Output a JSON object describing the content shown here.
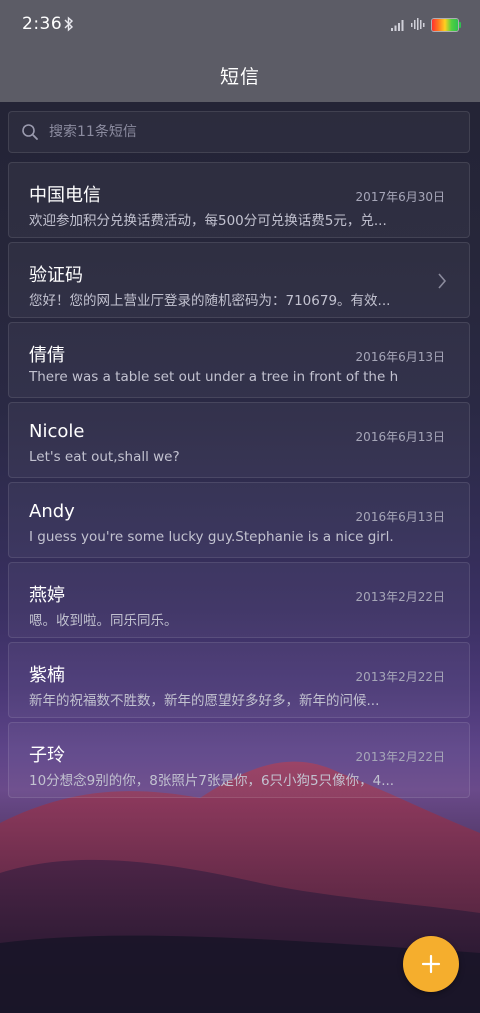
{
  "status_bar": {
    "time": "2:36"
  },
  "header": {
    "title": "短信"
  },
  "search": {
    "placeholder": "搜索11条短信"
  },
  "messages": [
    {
      "name": "中国电信",
      "date": "2017年6月30日",
      "preview": "欢迎参加积分兑换话费活动，每500分可兑换话费5元，兑..."
    },
    {
      "name": "验证码",
      "date": "",
      "preview": "您好！您的网上营业厅登录的随机密码为：710679。有效...",
      "has_chevron": true
    },
    {
      "name": "倩倩",
      "date": "2016年6月13日",
      "preview": "There was a table set out under a tree in front of the h..."
    },
    {
      "name": "Nicole",
      "date": "2016年6月13日",
      "preview": "Let's eat out,shall we?"
    },
    {
      "name": "Andy",
      "date": "2016年6月13日",
      "preview": "I guess you're some lucky guy.Stephanie is a nice girl."
    },
    {
      "name": "燕婷",
      "date": "2013年2月22日",
      "preview": "嗯。收到啦。同乐同乐。"
    },
    {
      "name": "紫楠",
      "date": "2013年2月22日",
      "preview": "新年的祝福数不胜数，新年的愿望好多好多，新年的问候..."
    },
    {
      "name": "子玲",
      "date": "2013年2月22日",
      "preview": "10分想念9别的你，8张照片7张是你，6只小狗5只像你，4..."
    }
  ],
  "icons": {
    "bluetooth": "bluetooth-icon",
    "signal": "signal-icon",
    "wifi": "wifi-icon",
    "battery": "battery-icon",
    "search": "search-icon",
    "chevron": "chevron-right-icon",
    "compose": "plus-icon"
  },
  "colors": {
    "accent": "#f5ae2d",
    "header_bg": "#5c5c66"
  }
}
